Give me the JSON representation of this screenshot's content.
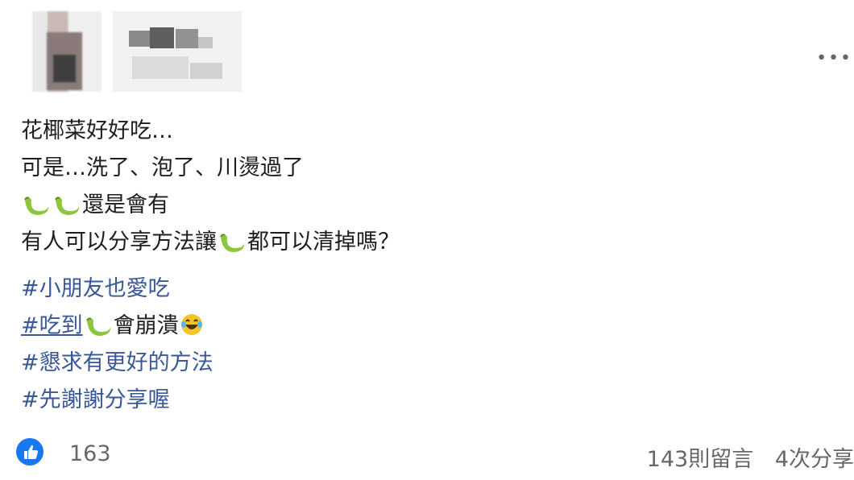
{
  "post": {
    "lines": [
      {
        "text": "花椰菜好好吃…"
      },
      {
        "text": "可是…洗了、泡了、川燙過了"
      },
      {
        "prefix_icons": [
          "caterpillar-icon",
          "caterpillar-icon"
        ],
        "text": "還是會有"
      },
      {
        "before": "有人可以分享方法讓",
        "icon": "caterpillar-icon",
        "after": "都可以清掉嗎？"
      }
    ],
    "hashtags": [
      {
        "text": "#小朋友也愛吃"
      },
      {
        "link": "#吃到",
        "icon": "caterpillar-icon",
        "after": "會崩潰",
        "emoji": "laughing-tears-emoji"
      },
      {
        "text": "#懇求有更好的方法"
      },
      {
        "text": "#先謝謝分享喔"
      }
    ]
  },
  "footer": {
    "reactions": "163",
    "comments": "143則留言",
    "shares": "4次分享"
  },
  "colors": {
    "hashtag": "#385898",
    "like": "#1877f2",
    "meta": "#65676b"
  }
}
